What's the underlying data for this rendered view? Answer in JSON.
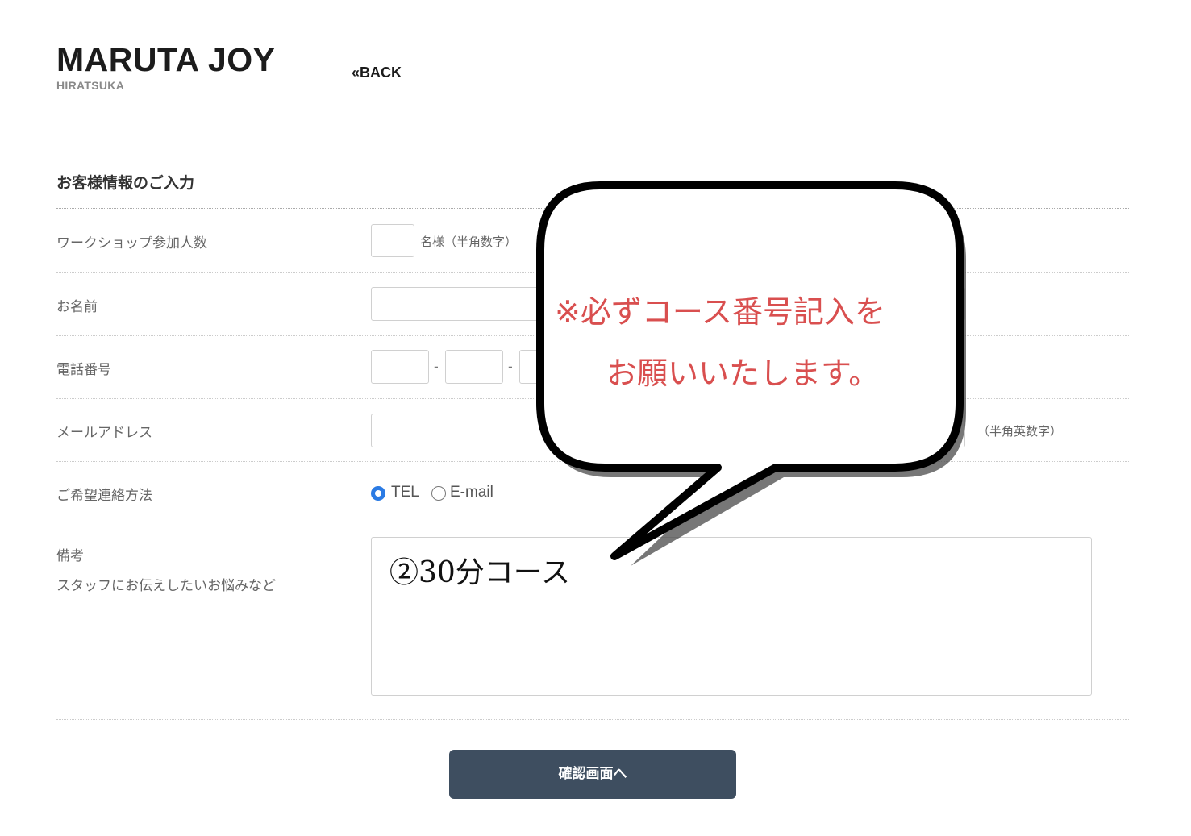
{
  "header": {
    "logo_name": "MARUTA JOY",
    "logo_sub": "HIRATSUKA",
    "back_label": "«BACK"
  },
  "form": {
    "section_title": "お客様情報のご入力",
    "participants": {
      "label": "ワークショップ参加人数",
      "value": "",
      "suffix": "名様（半角数字）"
    },
    "name": {
      "label": "お名前",
      "value": ""
    },
    "phone": {
      "label": "電話番号",
      "part1": "",
      "part2": "",
      "part3": "",
      "separator": "-"
    },
    "email": {
      "label": "メールアドレス",
      "value": "",
      "note": "（半角英数字）"
    },
    "contact_method": {
      "label": "ご希望連絡方法",
      "options": [
        "TEL",
        "E-mail"
      ],
      "selected": "TEL"
    },
    "remarks": {
      "label": "備考",
      "sublabel": "スタッフにお伝えしたいお悩みなど",
      "value": "②30分コース"
    },
    "submit_label": "確認画面へ"
  },
  "annotation": {
    "line1": "※必ずコース番号記入を",
    "line2": "お願いいたします。",
    "text_color": "#d94f4f"
  },
  "colors": {
    "button_bg": "#3e4e60",
    "radio_accent": "#2b7be4"
  }
}
